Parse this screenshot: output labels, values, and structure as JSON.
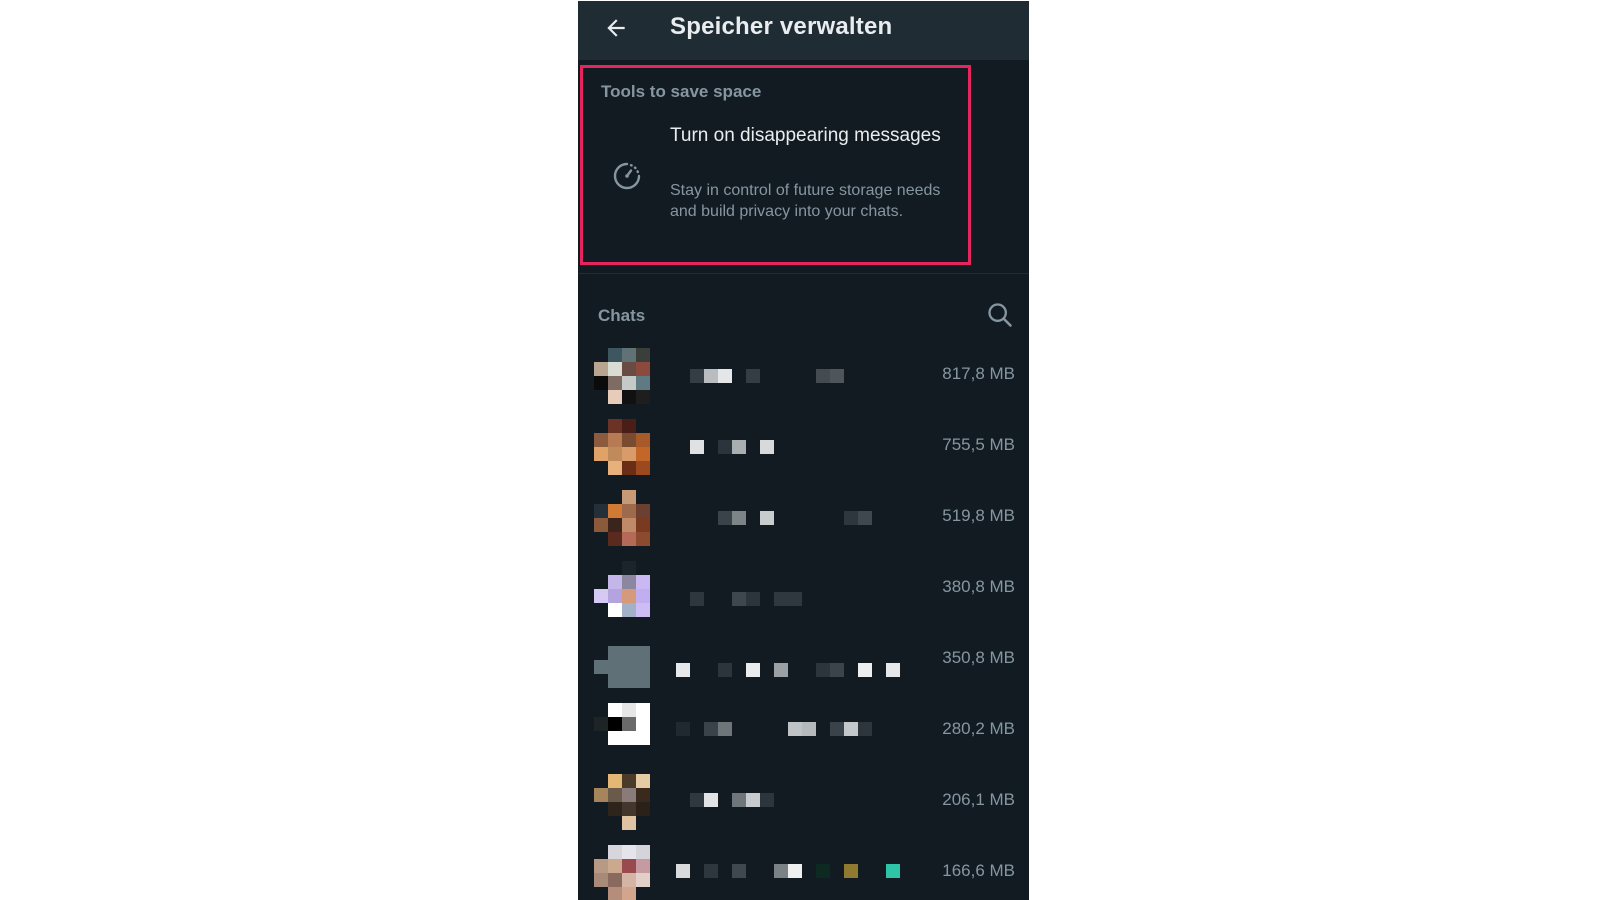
{
  "header": {
    "title": "Speicher verwalten",
    "back_icon": "arrow-left-icon"
  },
  "tools": {
    "section_label": "Tools to save space",
    "item": {
      "icon": "disappearing-timer-icon",
      "title": "Turn on disappearing messages",
      "description": "Stay in control of future storage needs and build privacy into your chats."
    }
  },
  "chats": {
    "section_label": "Chats",
    "search_icon": "search-icon",
    "items": [
      {
        "size": "817,8 MB"
      },
      {
        "size": "755,5 MB"
      },
      {
        "size": "519,8 MB"
      },
      {
        "size": "380,8 MB"
      },
      {
        "size": "350,8 MB"
      },
      {
        "size": "280,2 MB"
      },
      {
        "size": "206,1 MB"
      },
      {
        "size": "166,6 MB"
      }
    ]
  },
  "colors": {
    "background": "#121b22",
    "appbar": "#1f2c34",
    "highlight_border": "#e6245f",
    "primary_text": "#e9edef",
    "secondary_text": "#8696a0"
  }
}
